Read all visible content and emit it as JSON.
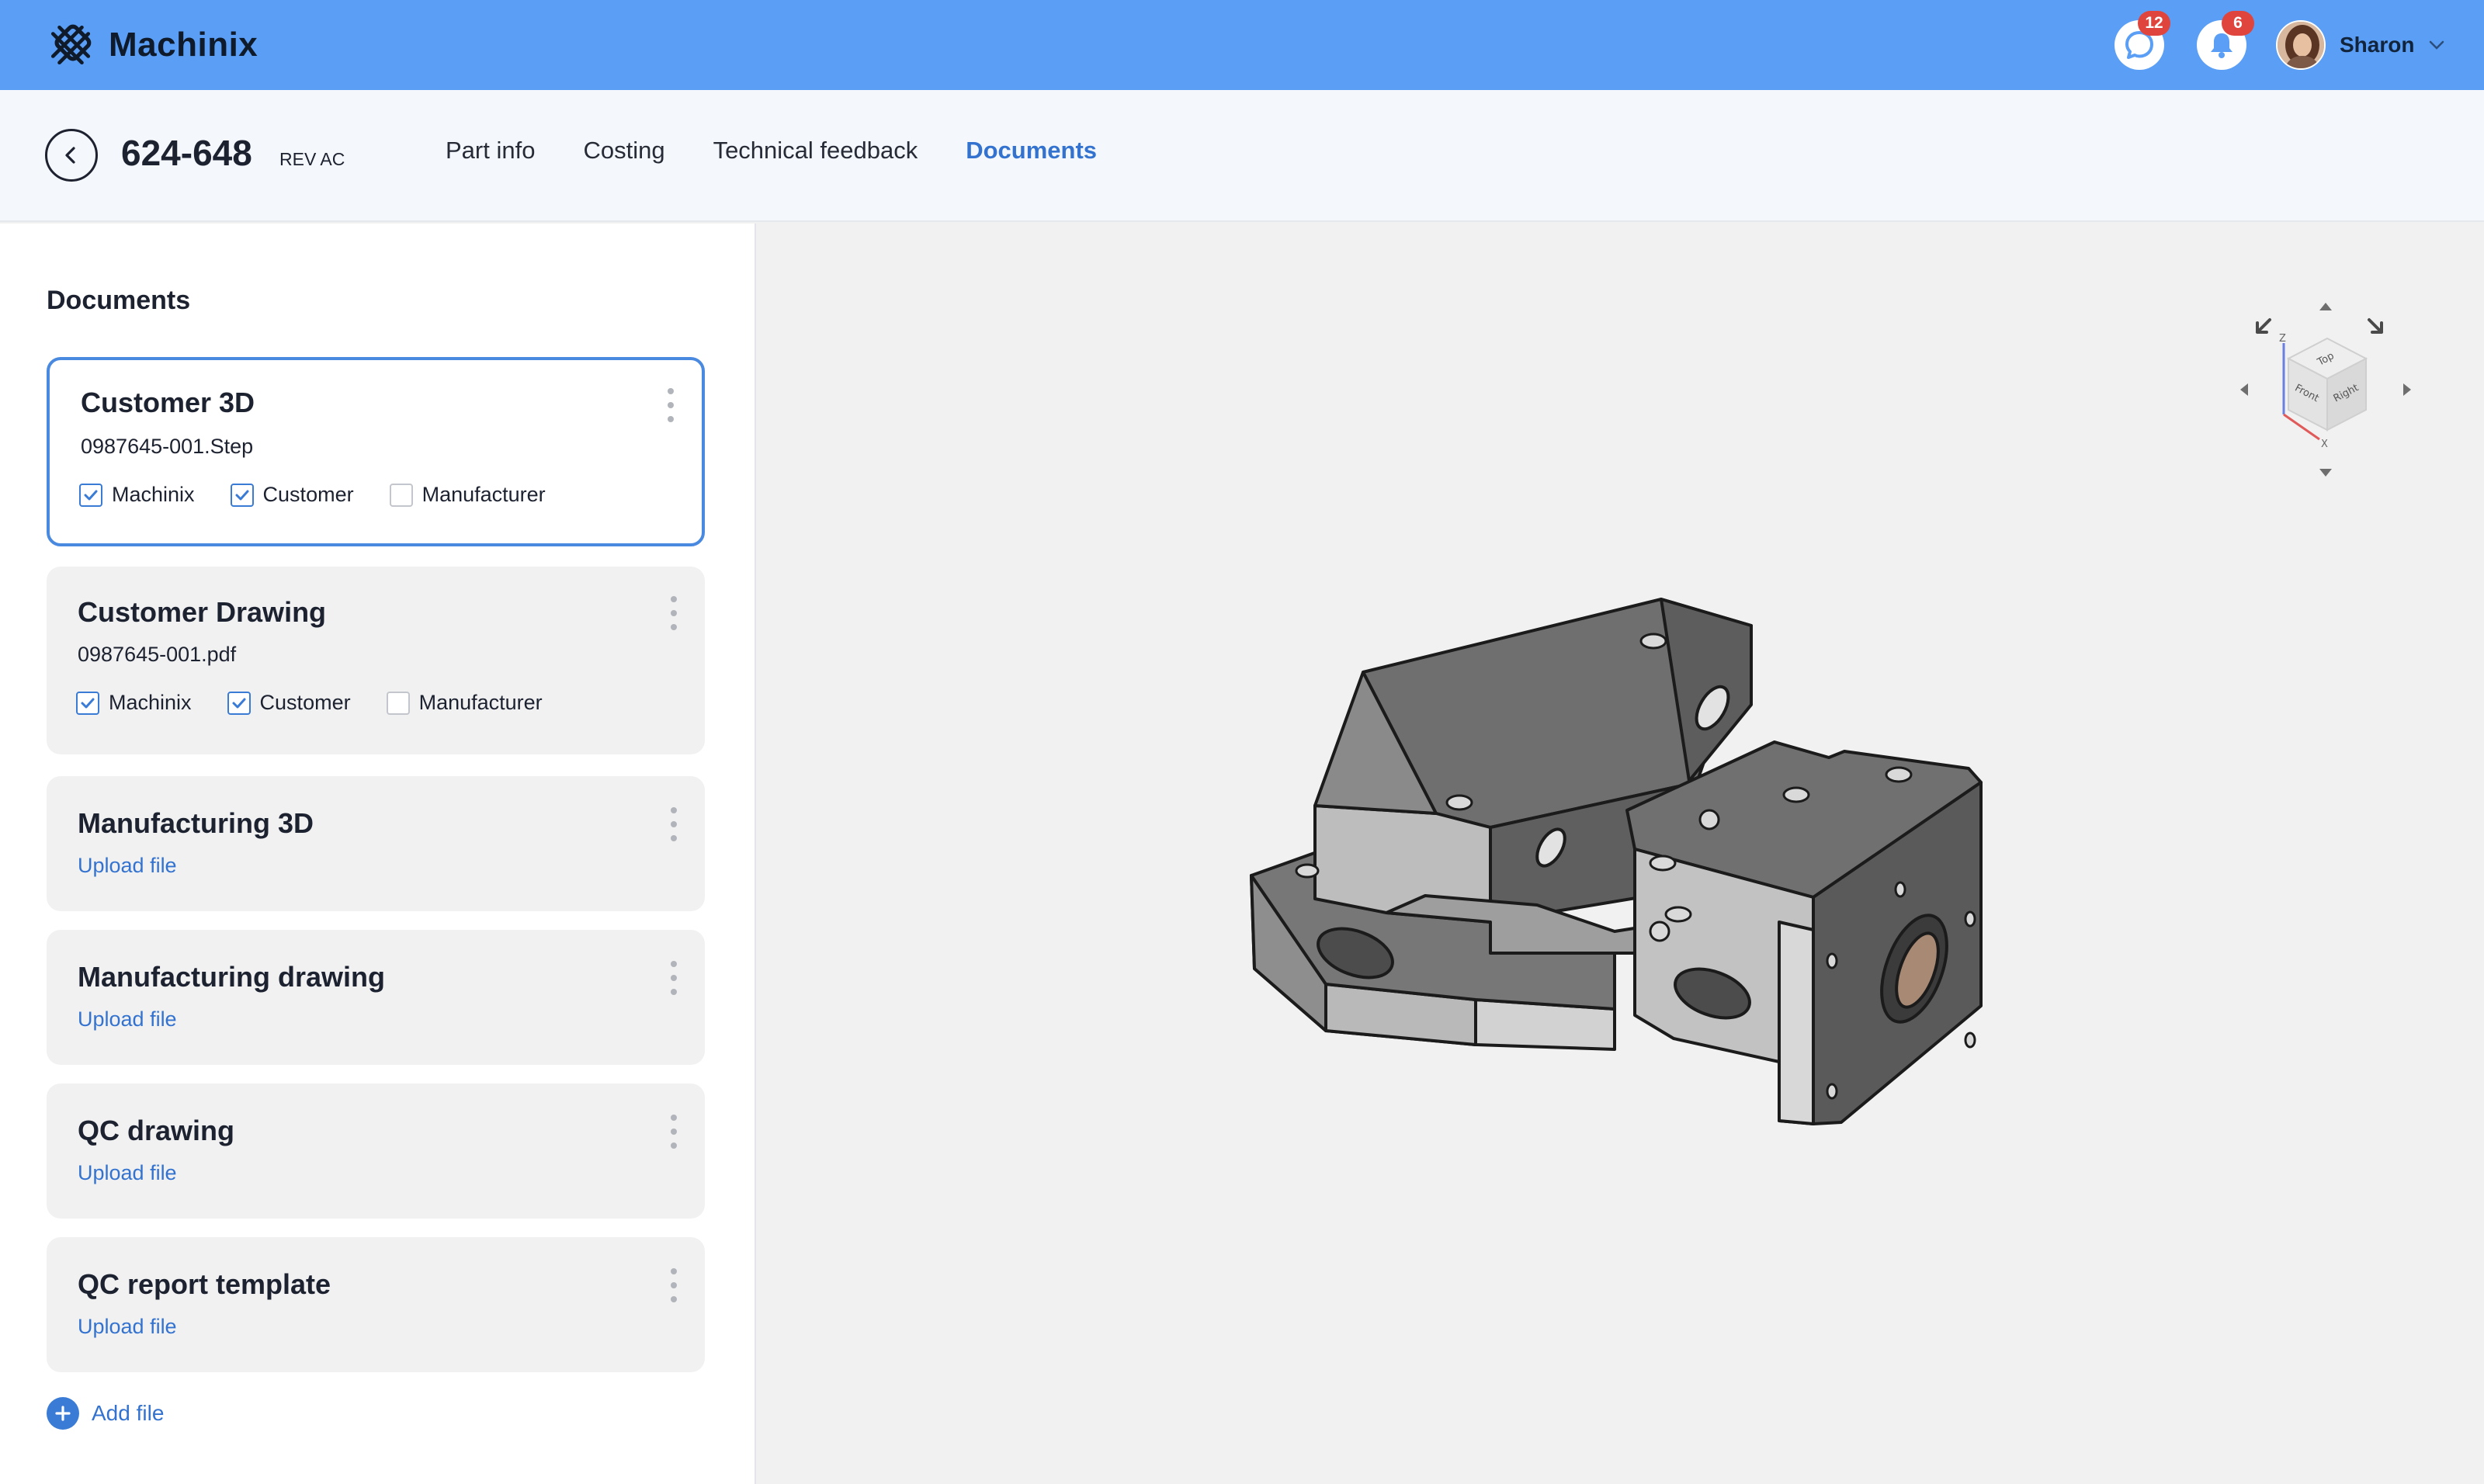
{
  "app": {
    "name": "Machinix"
  },
  "topbar": {
    "messages_badge": "12",
    "notifications_badge": "6",
    "user_name": "Sharon"
  },
  "part": {
    "number": "624-648",
    "revision": "REV AC"
  },
  "tabs": [
    {
      "label": "Part info",
      "active": false
    },
    {
      "label": "Costing",
      "active": false
    },
    {
      "label": "Technical feedback",
      "active": false
    },
    {
      "label": "Documents",
      "active": true
    }
  ],
  "documents": {
    "title": "Documents",
    "cards": [
      {
        "title": "Customer 3D",
        "file": "0987645-001.Step",
        "selected": true,
        "checks": [
          {
            "label": "Machinix",
            "checked": true
          },
          {
            "label": "Customer",
            "checked": true
          },
          {
            "label": "Manufacturer",
            "checked": false
          }
        ]
      },
      {
        "title": "Customer Drawing",
        "file": "0987645-001.pdf",
        "selected": false,
        "checks": [
          {
            "label": "Machinix",
            "checked": true
          },
          {
            "label": "Customer",
            "checked": true
          },
          {
            "label": "Manufacturer",
            "checked": false
          }
        ]
      },
      {
        "title": "Manufacturing 3D",
        "upload": "Upload file"
      },
      {
        "title": "Manufacturing drawing",
        "upload": "Upload file"
      },
      {
        "title": "QC drawing",
        "upload": "Upload file"
      },
      {
        "title": "QC report template",
        "upload": "Upload file"
      }
    ],
    "add_file_label": "Add file"
  },
  "viewer": {
    "navcube_faces": [
      "Top",
      "Front",
      "Right"
    ],
    "navcube_axes": [
      "Z",
      "X"
    ]
  },
  "colors": {
    "topbar": "#5a9ef5",
    "accent": "#3373cf",
    "badge": "#e0453d"
  }
}
